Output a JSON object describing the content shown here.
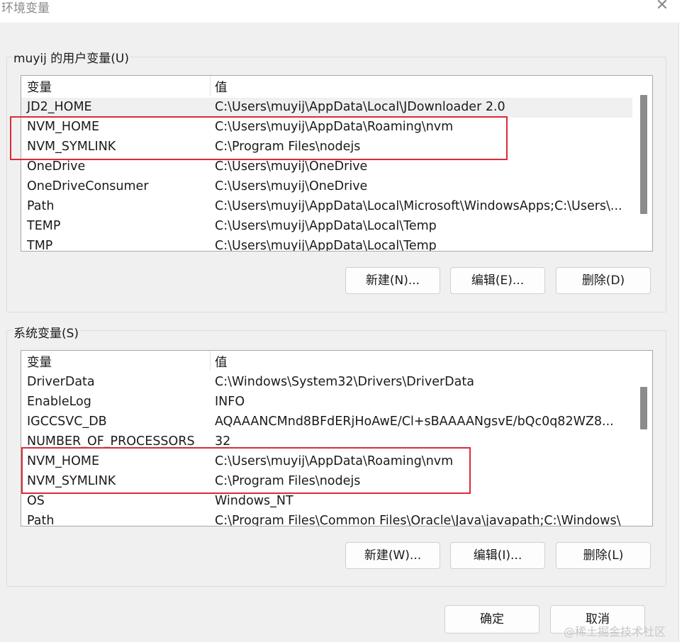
{
  "window": {
    "title": "环境变量",
    "close_glyph": "✕"
  },
  "user_group": {
    "label": "muyij 的用户变量(U)",
    "columns": {
      "name": "变量",
      "value": "值"
    },
    "rows": [
      {
        "name": "JD2_HOME",
        "value": "C:\\Users\\muyij\\AppData\\Local\\JDownloader 2.0",
        "selected": true
      },
      {
        "name": "NVM_HOME",
        "value": "C:\\Users\\muyij\\AppData\\Roaming\\nvm"
      },
      {
        "name": "NVM_SYMLINK",
        "value": "C:\\Program Files\\nodejs"
      },
      {
        "name": "OneDrive",
        "value": "C:\\Users\\muyij\\OneDrive"
      },
      {
        "name": "OneDriveConsumer",
        "value": "C:\\Users\\muyij\\OneDrive"
      },
      {
        "name": "Path",
        "value": "C:\\Users\\muyij\\AppData\\Local\\Microsoft\\WindowsApps;C:\\Users\\..."
      },
      {
        "name": "TEMP",
        "value": "C:\\Users\\muyij\\AppData\\Local\\Temp"
      },
      {
        "name": "TMP",
        "value": "C:\\Users\\muyij\\AppData\\Local\\Temp"
      }
    ],
    "buttons": {
      "new": "新建(N)...",
      "edit": "编辑(E)...",
      "delete": "删除(D)"
    }
  },
  "system_group": {
    "label": "系统变量(S)",
    "columns": {
      "name": "变量",
      "value": "值"
    },
    "rows": [
      {
        "name": "DriverData",
        "value": "C:\\Windows\\System32\\Drivers\\DriverData"
      },
      {
        "name": "EnableLog",
        "value": "INFO"
      },
      {
        "name": "IGCCSVC_DB",
        "value": "AQAAANCMnd8BFdERjHoAwE/Cl+sBAAAANgsvE/bQc0q82WZ8..."
      },
      {
        "name": "NUMBER_OF_PROCESSORS",
        "value": "32"
      },
      {
        "name": "NVM_HOME",
        "value": "C:\\Users\\muyij\\AppData\\Roaming\\nvm"
      },
      {
        "name": "NVM_SYMLINK",
        "value": "C:\\Program Files\\nodejs"
      },
      {
        "name": "OS",
        "value": "Windows_NT"
      },
      {
        "name": "Path",
        "value": "C:\\Program Files\\Common Files\\Oracle\\Java\\javapath;C:\\Windows\\"
      }
    ],
    "buttons": {
      "new": "新建(W)...",
      "edit": "编辑(I)...",
      "delete": "删除(L)"
    }
  },
  "dialog_buttons": {
    "ok": "确定",
    "cancel": "取消"
  },
  "watermark": "@稀土掘金技术社区",
  "highlight_color": "#d92b3a"
}
